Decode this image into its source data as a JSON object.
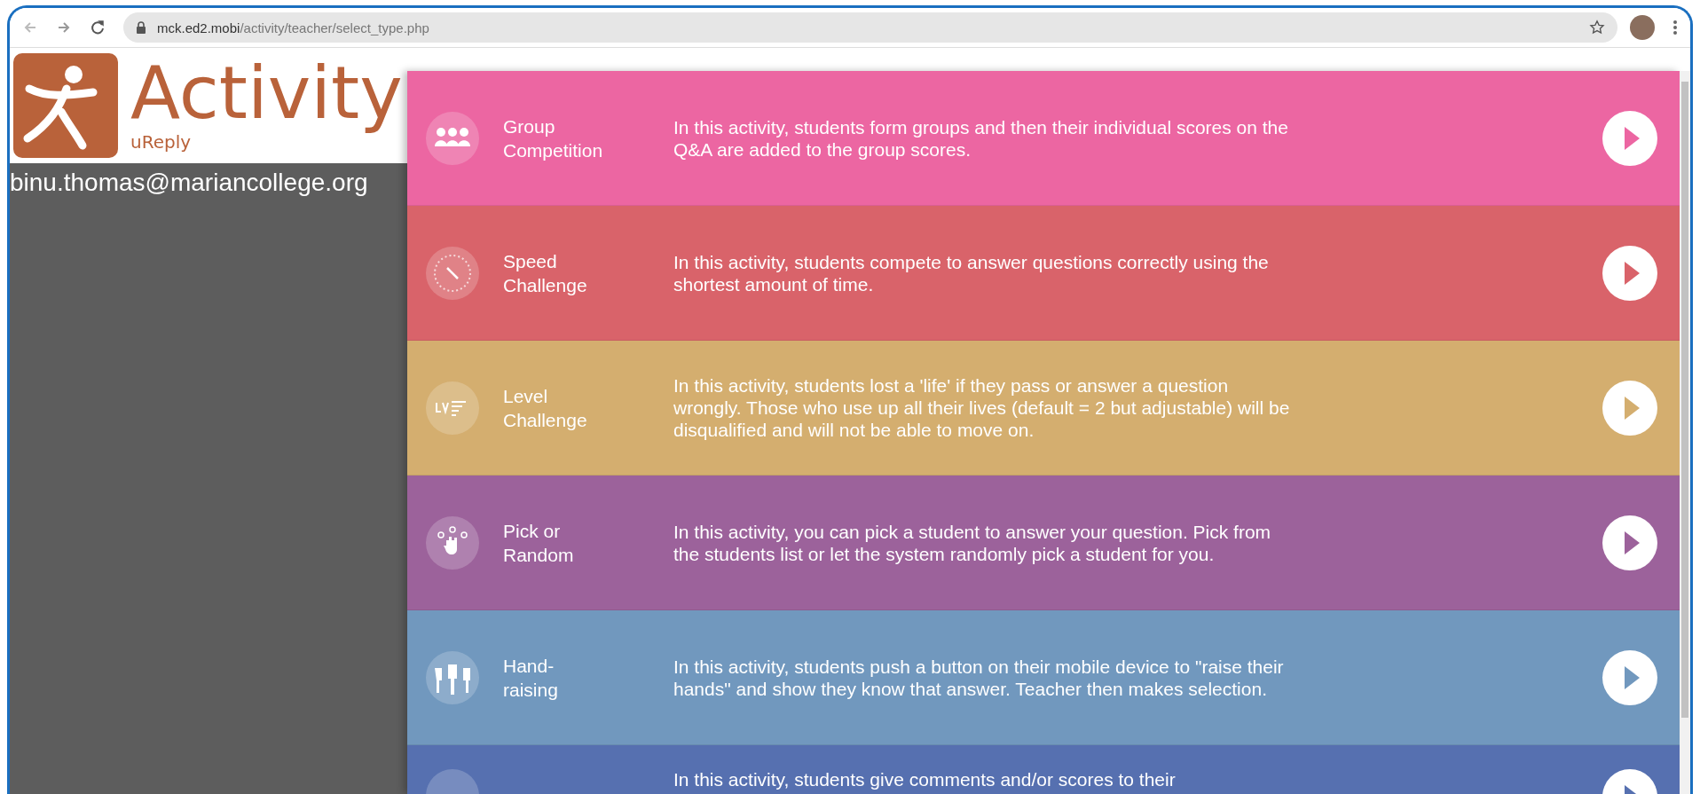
{
  "browser": {
    "url_host": "mck.ed2.mobi",
    "url_path": "/activity/teacher/select_type.php"
  },
  "logo": {
    "title": "Activity",
    "subtitle": "uReply"
  },
  "user_email": "binu.thomas@mariancollege.org",
  "activities": [
    {
      "kind": "group",
      "title_lines": [
        "Group",
        "Competition"
      ],
      "description": "In this activity, students form groups and then their individual scores on the Q&A are added to the group scores.",
      "color": "#ec66a2"
    },
    {
      "kind": "speed",
      "title_lines": [
        "Speed",
        "Challenge"
      ],
      "description": "In this activity, students compete to answer questions correctly using the shortest amount of time.",
      "color": "#d9636a"
    },
    {
      "kind": "level",
      "title_lines": [
        "Level",
        "Challenge"
      ],
      "description": "In this activity, students lost a 'life' if they pass or answer a question wrongly. Those who use up all their lives (default = 2 but adjustable) will be disqualified and will not be able to move on.",
      "color": "#d4ae6f"
    },
    {
      "kind": "pick",
      "title_lines": [
        "Pick or",
        "Random"
      ],
      "description": "In this activity, you can pick a student to answer your question. Pick from the students list or let the system randomly pick a student for you.",
      "color": "#9c629b"
    },
    {
      "kind": "hands",
      "title_lines": [
        "Hand-",
        "raising"
      ],
      "description": "In this activity, students push a button on their mobile device to \"raise their hands\" and show they know that answer. Teacher then makes selection.",
      "color": "#7198be"
    },
    {
      "kind": "partial",
      "description": "In this activity, students give comments and/or scores to their",
      "color": "#5670b0"
    }
  ]
}
